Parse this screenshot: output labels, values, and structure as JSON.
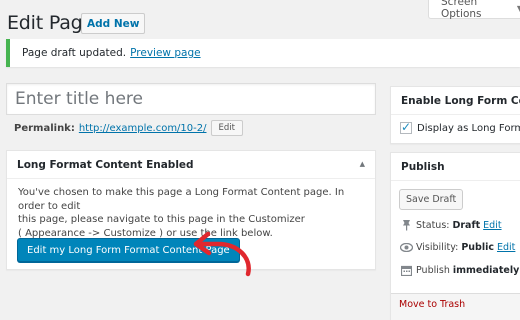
{
  "screen_options": {
    "label": "Screen Options",
    "caret": "▼"
  },
  "header": {
    "title": "Edit Page",
    "add_new": "Add New"
  },
  "notice": {
    "text": "Page draft updated.",
    "link": "Preview page",
    "color": "#46b450"
  },
  "editor": {
    "title_placeholder": "Enter title here",
    "permalink_label": "Permalink:",
    "permalink_url": "http://example.com/10-2/",
    "permalink_edit": "Edit"
  },
  "long_format_box": {
    "title": "Long Format Content Enabled",
    "toggle": "▲",
    "line1": "You've chosen to make this page a Long Format Content page. In order to edit",
    "line2": "this page, please navigate to this page in the Customizer",
    "line3": "( Appearance -> Customize ) or use the link below.",
    "button": "Edit my Long Form Format Content Page",
    "button_color": "#0085ba",
    "arrow_color": "#e0282e"
  },
  "enable_box": {
    "title": "Enable Long Form Conte",
    "checkbox_label": "Display as Long Form Co",
    "checked": true
  },
  "publish_box": {
    "title": "Publish",
    "save_draft": "Save Draft",
    "status_label": "Status:",
    "status_value": "Draft",
    "visibility_label": "Visibility:",
    "visibility_value": "Public",
    "publish_label": "Publish",
    "publish_value": "immediately",
    "edit": "Edit",
    "trash": "Move to Trash"
  }
}
